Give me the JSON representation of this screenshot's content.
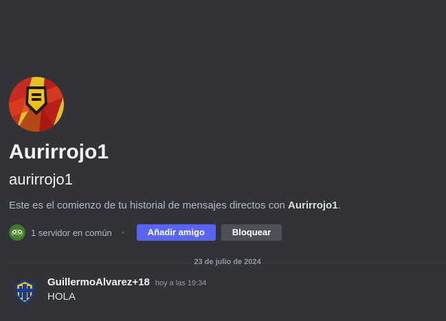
{
  "profile": {
    "display_name": "Aurirrojo1",
    "username": "aurirrojo1",
    "intro_prefix": "Este es el comienzo de tu historial de mensajes directos con ",
    "intro_name": "Aurirrojo1",
    "intro_suffix": ".",
    "mutual_servers": "1 servidor en común"
  },
  "actions": {
    "add_friend": "Añadir amigo",
    "block": "Bloquear"
  },
  "divider": {
    "date": "23 de julio de 2024"
  },
  "messages": [
    {
      "author": "GuillermoAlvarez+18",
      "timestamp": "hoy a las 19:34",
      "content": "HOLA"
    }
  ],
  "colors": {
    "background": "#313338",
    "primary_button": "#5865f2",
    "secondary_button": "#4e5058",
    "text_muted": "#b5bac1"
  }
}
